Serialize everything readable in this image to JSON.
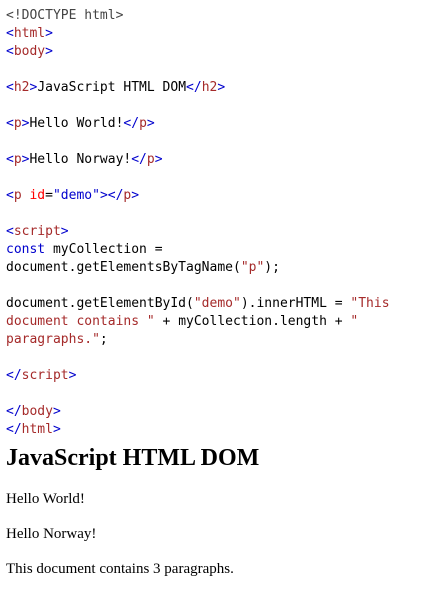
{
  "code": {
    "doctype": "<!DOCTYPE html>",
    "html_open": "html",
    "body_open": "body",
    "h2_tag": "h2",
    "h2_text": "JavaScript HTML DOM",
    "p_tag": "p",
    "p1_text": "Hello World!",
    "p2_text": "Hello Norway!",
    "p3_attr": "id",
    "p3_value": "\"demo\"",
    "script_tag": "script",
    "line_const_kw": "const",
    "line_const_rest": " myCollection =",
    "line_get_tag_prefix": "document.getElementsByTagName(",
    "line_get_tag_arg": "\"p\"",
    "line_get_tag_suffix": ");",
    "line_inner_prefix": "document.getElementById(",
    "line_inner_arg": "\"demo\"",
    "line_inner_mid": ").innerHTML = ",
    "line_inner_str1": "\"This",
    "line_doc_str": "document contains \"",
    "line_doc_mid": " + myCollection.length + ",
    "line_doc_str2": "\"",
    "line_para_str": "paragraphs.\"",
    "line_para_end": ";",
    "body_close": "body",
    "html_close": "html"
  },
  "render": {
    "heading": "JavaScript HTML DOM",
    "para1": "Hello World!",
    "para2": "Hello Norway!",
    "demo": "This document contains 3 paragraphs."
  }
}
